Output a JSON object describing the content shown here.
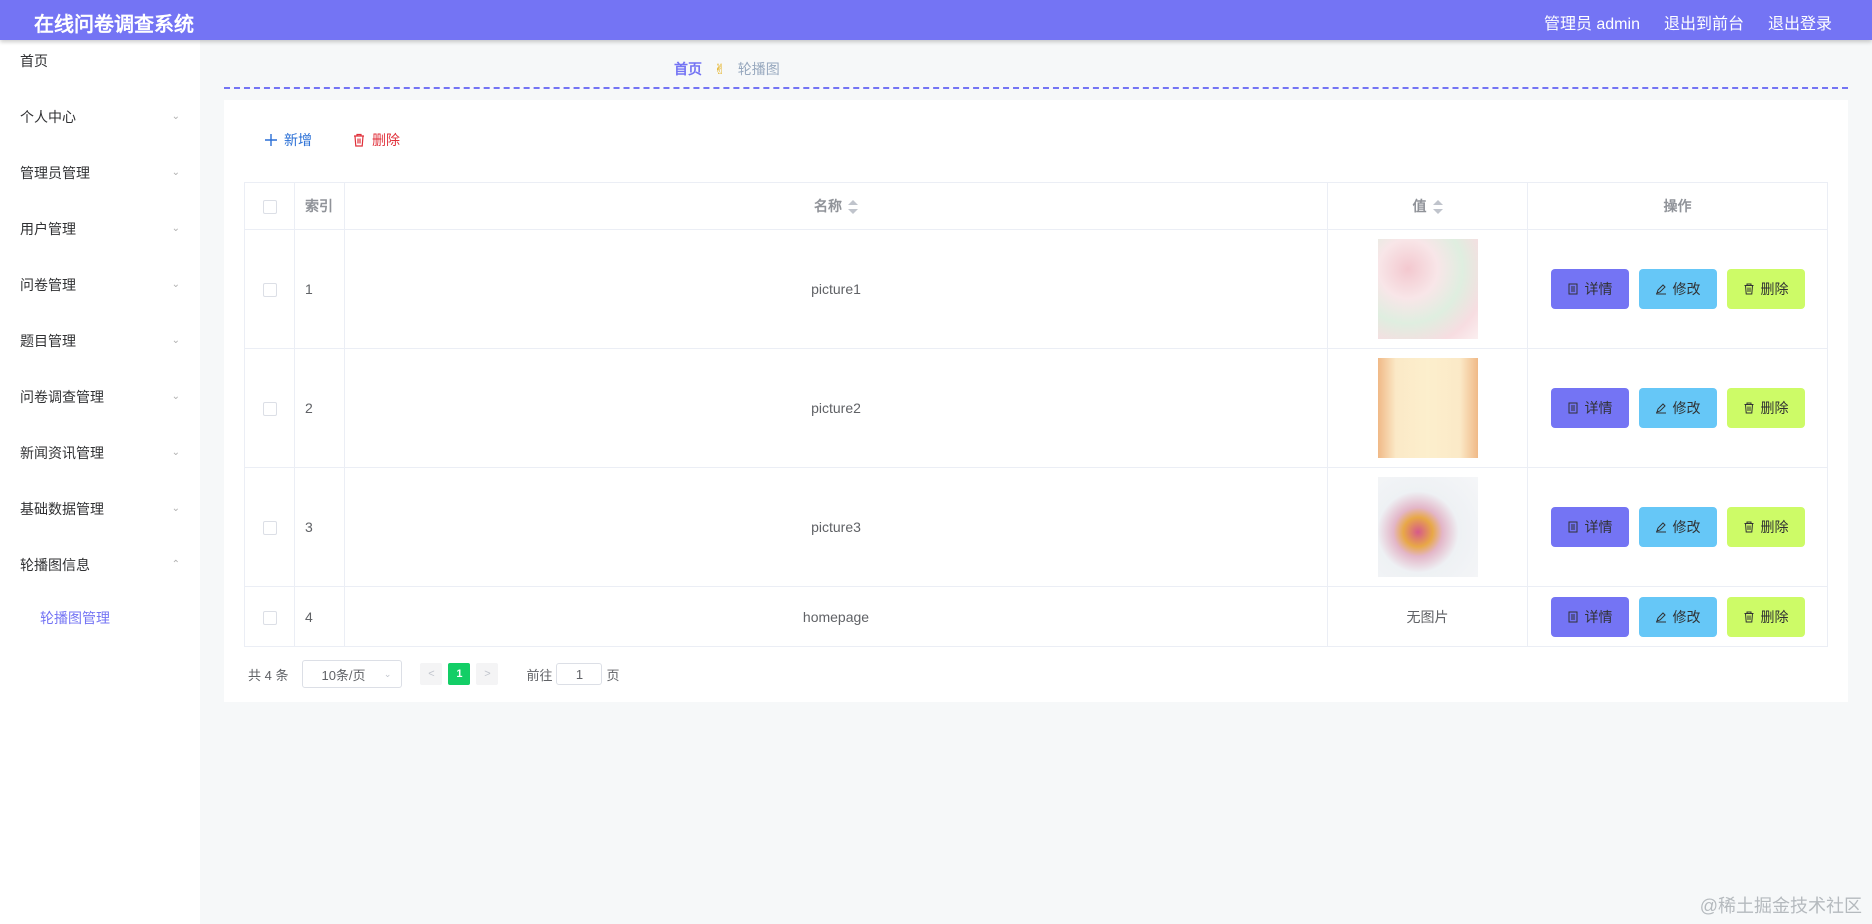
{
  "header": {
    "title": "在线问卷调查系统",
    "user_label": "管理员 admin",
    "to_frontend": "退出到前台",
    "logout": "退出登录"
  },
  "sidebar": {
    "items": [
      {
        "label": "首页",
        "chevron": ""
      },
      {
        "label": "个人中心",
        "chevron": "chevron-down-icon"
      },
      {
        "label": "管理员管理",
        "chevron": "chevron-down-icon"
      },
      {
        "label": "用户管理",
        "chevron": "chevron-down-icon"
      },
      {
        "label": "问卷管理",
        "chevron": "chevron-down-icon"
      },
      {
        "label": "题目管理",
        "chevron": "chevron-down-icon"
      },
      {
        "label": "问卷调查管理",
        "chevron": "chevron-down-icon"
      },
      {
        "label": "新闻资讯管理",
        "chevron": "chevron-down-icon"
      },
      {
        "label": "基础数据管理",
        "chevron": "chevron-down-icon"
      },
      {
        "label": "轮播图信息",
        "chevron": "chevron-up-icon"
      }
    ],
    "submenu": {
      "label": "轮播图管理"
    }
  },
  "breadcrumb": {
    "home": "首页",
    "separator": "✌",
    "current": "轮播图"
  },
  "toolbar": {
    "add_label": "新增",
    "delete_label": "删除"
  },
  "table": {
    "headers": {
      "index": "索引",
      "name": "名称",
      "value": "值",
      "actions": "操作"
    },
    "rows": [
      {
        "index": "1",
        "name": "picture1",
        "value": "",
        "thumb": "thumb-1"
      },
      {
        "index": "2",
        "name": "picture2",
        "value": "",
        "thumb": "thumb-2"
      },
      {
        "index": "3",
        "name": "picture3",
        "value": "",
        "thumb": "thumb-3"
      },
      {
        "index": "4",
        "name": "homepage",
        "value": "无图片",
        "thumb": ""
      }
    ],
    "actions": {
      "detail": "详情",
      "edit": "修改",
      "remove": "删除"
    }
  },
  "pagination": {
    "total": "共 4 条",
    "page_size": "10条/页",
    "current_page": "1",
    "goto_prefix": "前往",
    "goto_value": "1",
    "goto_suffix": "页"
  },
  "watermark": "@稀土掘金技术社区",
  "colors": {
    "primary": "#7474f4",
    "edit": "#66c7f7",
    "remove": "#cdfb67",
    "active_page": "#13ce66"
  }
}
